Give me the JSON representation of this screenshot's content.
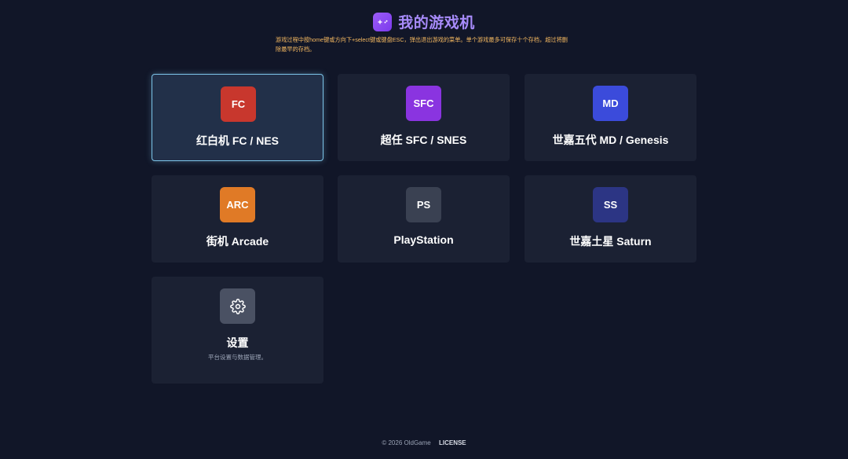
{
  "header": {
    "title": "我的游戏机",
    "logo_icon": "gamepad-icon",
    "notice": "游戏过程中按home键或方向下+select键或键盘ESC，弹出退出游戏的菜单。单个游戏最多可保存十个存档，超过将删除最早的存档。"
  },
  "consoles": [
    {
      "badge": "FC",
      "label": "红白机 FC / NES",
      "color": "#c8372d",
      "active": true
    },
    {
      "badge": "SFC",
      "label": "超任 SFC / SNES",
      "color": "#8a34e0",
      "active": false
    },
    {
      "badge": "MD",
      "label": "世嘉五代 MD / Genesis",
      "color": "#3b4bdb",
      "active": false
    },
    {
      "badge": "ARC",
      "label": "街机 Arcade",
      "color": "#e07a26",
      "active": false
    },
    {
      "badge": "PS",
      "label": "PlayStation",
      "color": "#3a4152",
      "active": false
    },
    {
      "badge": "SS",
      "label": "世嘉土星 Saturn",
      "color": "#2c3584",
      "active": false
    }
  ],
  "settings": {
    "label": "设置",
    "description": "平台设置与数据管理。",
    "icon": "gear-icon",
    "color": "#4a5163"
  },
  "footer": {
    "copyright": "© 2026 OldGame",
    "license": "LICENSE"
  }
}
